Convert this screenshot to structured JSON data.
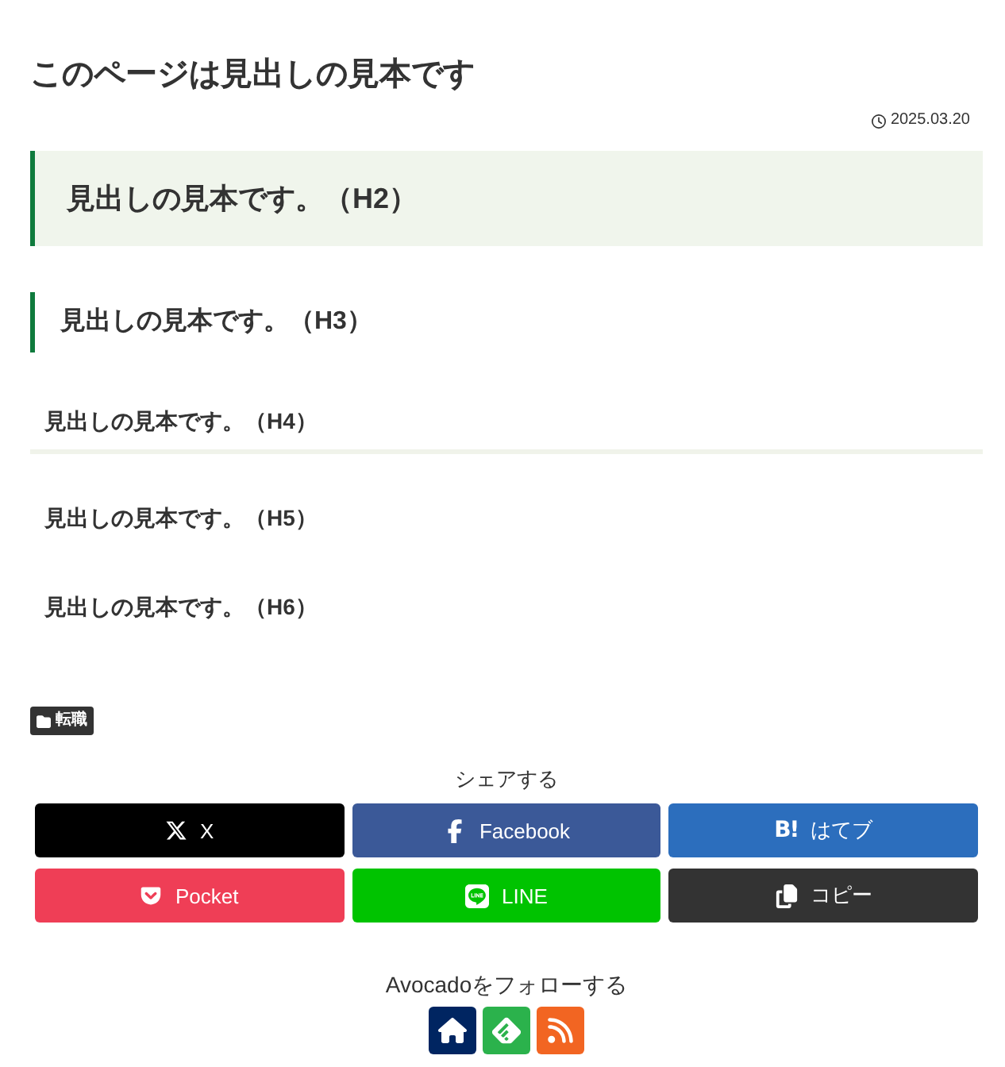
{
  "article": {
    "title": "このページは見出しの見本です",
    "date": "2025.03.20"
  },
  "headings": [
    {
      "kind": "h2",
      "text": "見出しの見本です。（H2）"
    },
    {
      "kind": "h3",
      "text": "見出しの見本です。（H3）"
    },
    {
      "kind": "h4",
      "text": "見出しの見本です。（H4）"
    },
    {
      "kind": "h5",
      "text": "見出しの見本です。（H5）"
    },
    {
      "kind": "h6",
      "text": "見出しの見本です。（H6）"
    }
  ],
  "category_tag": "転職",
  "share": {
    "title": "シェアする",
    "buttons": [
      {
        "kind": "x",
        "label": "X"
      },
      {
        "kind": "facebook",
        "label": "Facebook"
      },
      {
        "kind": "hatena",
        "icon": "B!",
        "label": "はてブ"
      },
      {
        "kind": "pocket",
        "label": "Pocket"
      },
      {
        "kind": "line",
        "label": "LINE"
      },
      {
        "kind": "copy",
        "label": "コピー"
      }
    ]
  },
  "follow": {
    "title": "Avocadoをフォローする",
    "buttons": [
      {
        "kind": "home"
      },
      {
        "kind": "feedly"
      },
      {
        "kind": "rss"
      }
    ]
  }
}
